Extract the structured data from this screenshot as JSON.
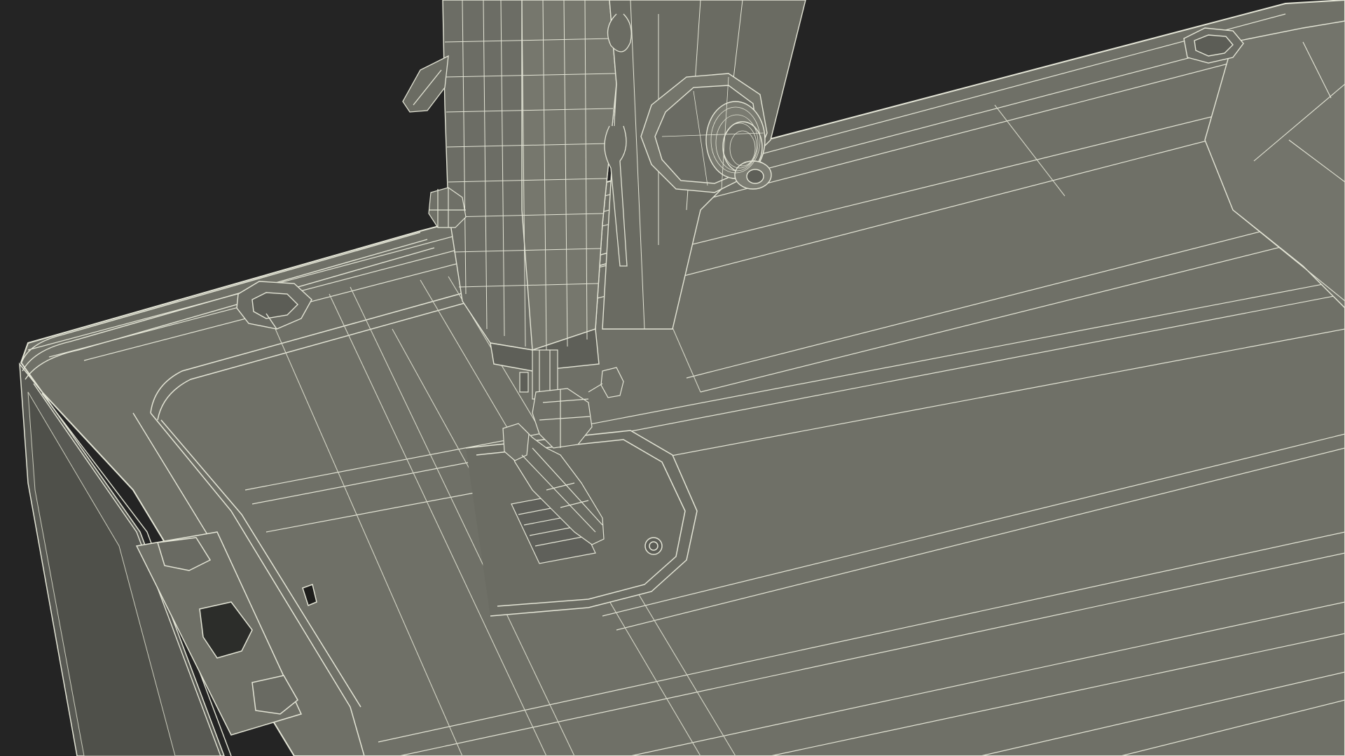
{
  "scene": {
    "subject": "sewing-machine-wireframe",
    "colors": {
      "background": "#242424",
      "surface": "#6f7067",
      "surface_light": "#7b7c72",
      "surface_dark": "#5b5c55",
      "side": "#4f504a",
      "wire": "#e4e5d6",
      "wire_faint": "#b9baa9"
    }
  }
}
